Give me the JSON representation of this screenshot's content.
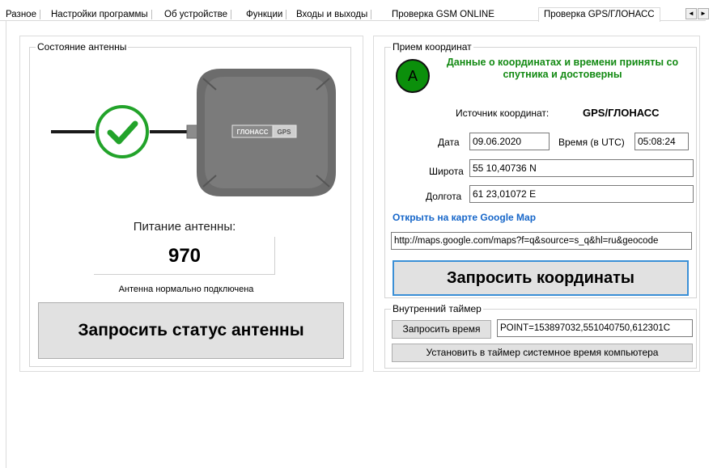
{
  "tabs": [
    {
      "label": "Разное"
    },
    {
      "label": "Настройки программы"
    },
    {
      "label": "Об устройстве"
    },
    {
      "label": "Функции"
    },
    {
      "label": "Входы и выходы"
    },
    {
      "label": "Проверка GSM ONLINE"
    },
    {
      "label": "Проверка GPS/ГЛОНАСС"
    }
  ],
  "tab_scroll": {
    "left": "◄",
    "right": "►"
  },
  "antenna": {
    "group_title": "Состояние антенны",
    "device_label_left": "ГЛОНАСС",
    "device_label_right": "GPS",
    "power_label": "Питание антенны:",
    "power_value": "970",
    "status_text": "Антенна нормально подключена",
    "request_button": "Запросить статус антенны",
    "status_color": "#22a32a"
  },
  "coords": {
    "group_title": "Прием координат",
    "status_letter": "A",
    "status_message": "Данные о координатах и времени приняты со спутника и достоверны",
    "source_label": "Источник координат:",
    "source_value": "GPS/ГЛОНАСС",
    "date_label": "Дата",
    "date_value": "09.06.2020",
    "time_label": "Время (в UTC)",
    "time_value": "05:08:24",
    "lat_label": "Широта",
    "lat_value": "55 10,40736 N",
    "lon_label": "Долгота",
    "lon_value": "61 23,01072 E",
    "map_link": "Открыть на карте Google Map",
    "map_url": "http://maps.google.com/maps?f=q&source=s_q&hl=ru&geocode",
    "request_button": "Запросить координаты"
  },
  "timer": {
    "group_title": "Внутренний таймер",
    "request_time_button": "Запросить время",
    "point_value": "POINT=153897032,551040750,612301C",
    "set_system_time_button": "Установить в таймер системное время компьютера"
  }
}
